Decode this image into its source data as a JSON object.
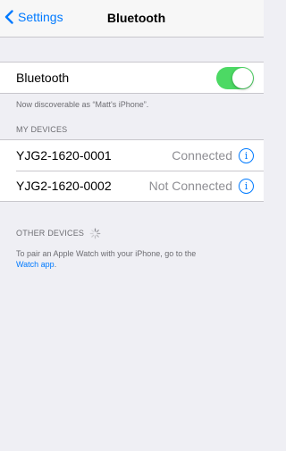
{
  "nav": {
    "back_label": "Settings",
    "title": "Bluetooth"
  },
  "bluetooth": {
    "label": "Bluetooth",
    "enabled": true,
    "toggle_color": "#4cd964",
    "discoverable_text": "Now discoverable as “Matt's iPhone”."
  },
  "my_devices": {
    "header": "MY DEVICES",
    "items": [
      {
        "name": "YJG2-1620-0001",
        "status": "Connected",
        "info_icon": "info-icon"
      },
      {
        "name": "YJG2-1620-0002",
        "status": "Not Connected",
        "info_icon": "info-icon"
      }
    ]
  },
  "other_devices": {
    "header": "OTHER DEVICES",
    "spinner_icon": "activity-spinner-icon",
    "hint_text": "To pair an Apple Watch with your iPhone, go to the",
    "hint_link": "Watch app",
    "hint_end": "."
  },
  "colors": {
    "accent": "#007aff",
    "background": "#efeff4"
  }
}
